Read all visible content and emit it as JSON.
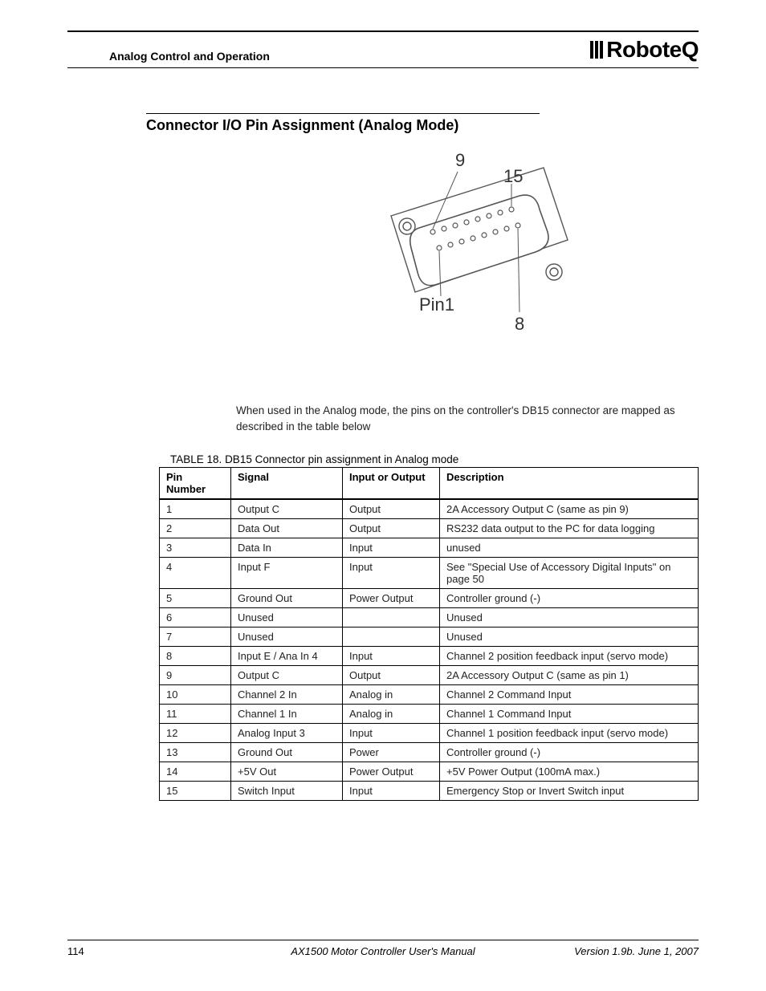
{
  "header": {
    "section": "Analog Control and Operation",
    "brand": "RoboteQ"
  },
  "title": "Connector I/O Pin Assignment (Analog Mode)",
  "figure": {
    "label_top_left": "9",
    "label_top_right": "15",
    "label_bottom_left": "Pin1",
    "label_bottom_right": "8"
  },
  "intro": "When used in the Analog mode, the pins on the controller's DB15 connector are mapped as described in the table below",
  "table": {
    "caption_prefix": "TABLE 18.",
    "caption": "DB15 Connector pin assignment in Analog mode",
    "headers": {
      "pin": "Pin Number",
      "signal": "Signal",
      "io": "Input or Output",
      "desc": "Description"
    },
    "rows": [
      {
        "pin": "1",
        "signal": "Output C",
        "io": "Output",
        "desc": "2A Accessory Output C (same as pin 9)"
      },
      {
        "pin": "2",
        "signal": "Data Out",
        "io": "Output",
        "desc": "RS232 data output to the PC for data logging"
      },
      {
        "pin": "3",
        "signal": "Data In",
        "io": "Input",
        "desc": "unused"
      },
      {
        "pin": "4",
        "signal": "Input F",
        "io": "Input",
        "desc": "See \"Special Use of Accessory Digital Inputs\" on page 50"
      },
      {
        "pin": "5",
        "signal": "Ground Out",
        "io": "Power Output",
        "desc": "Controller ground (-)"
      },
      {
        "pin": "6",
        "signal": "Unused",
        "io": "",
        "desc": "Unused"
      },
      {
        "pin": "7",
        "signal": "Unused",
        "io": "",
        "desc": "Unused"
      },
      {
        "pin": "8",
        "signal": "Input E / Ana In 4",
        "io": "Input",
        "desc": "Channel 2 position feedback input (servo mode)"
      },
      {
        "pin": "9",
        "signal": "Output C",
        "io": "Output",
        "desc": "2A Accessory Output C (same as pin 1)"
      },
      {
        "pin": "10",
        "signal": "Channel 2 In",
        "io": "Analog in",
        "desc": "Channel 2 Command Input"
      },
      {
        "pin": "11",
        "signal": "Channel 1 In",
        "io": "Analog in",
        "desc": "Channel 1 Command Input"
      },
      {
        "pin": "12",
        "signal": "Analog Input 3",
        "io": "Input",
        "desc": "Channel 1 position feedback input (servo mode)"
      },
      {
        "pin": "13",
        "signal": "Ground Out",
        "io": "Power",
        "desc": "Controller ground (-)"
      },
      {
        "pin": "14",
        "signal": "+5V Out",
        "io": "Power Output",
        "desc": "+5V Power Output (100mA max.)"
      },
      {
        "pin": "15",
        "signal": "Switch Input",
        "io": "Input",
        "desc": "Emergency Stop or Invert Switch input"
      }
    ]
  },
  "footer": {
    "page": "114",
    "manual": "AX1500 Motor Controller User's Manual",
    "version": "Version 1.9b. June 1, 2007"
  }
}
